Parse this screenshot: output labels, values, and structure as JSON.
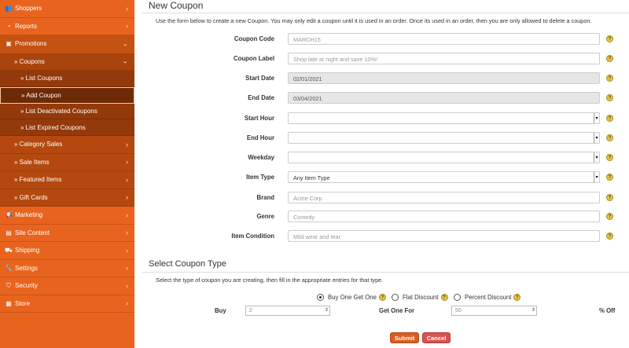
{
  "sidebar": {
    "items": [
      {
        "icon": "users-icon",
        "glyph": "👥",
        "label": "Shoppers"
      },
      {
        "icon": "chart-icon",
        "glyph": "◔",
        "label": "Reports"
      },
      {
        "icon": "promo-icon",
        "glyph": "▣",
        "label": "Promotions"
      },
      {
        "label": "» Coupons"
      },
      {
        "label": "» List Coupons"
      },
      {
        "label": "» Add Coupon"
      },
      {
        "label": "» List Deactivated Coupons"
      },
      {
        "label": "» List Expired Coupons"
      },
      {
        "label": "» Category Sales"
      },
      {
        "label": "» Sale Items"
      },
      {
        "label": "» Featured Items"
      },
      {
        "label": "» Gift Cards"
      },
      {
        "icon": "bullhorn-icon",
        "glyph": "📢",
        "label": "Marketing"
      },
      {
        "icon": "file-icon",
        "glyph": "▤",
        "label": "Site Content"
      },
      {
        "icon": "truck-icon",
        "glyph": "⛟",
        "label": "Shipping"
      },
      {
        "icon": "wrench-icon",
        "glyph": "🔧",
        "label": "Settings"
      },
      {
        "icon": "shield-icon",
        "glyph": "⛉",
        "label": "Security"
      },
      {
        "icon": "store-icon",
        "glyph": "▦",
        "label": "Store"
      }
    ]
  },
  "page": {
    "title": "New Coupon",
    "intro": "Use the form below to create a new Coupon. You may only edit a coupon until it is used in an order. Once its used in an order, then you are only allowed to delete a coupon."
  },
  "form": {
    "coupon_code": {
      "label": "Coupon Code",
      "placeholder": "MARCH15"
    },
    "coupon_label": {
      "label": "Coupon Label",
      "placeholder": "Shop late at night and save 10%!"
    },
    "start_date": {
      "label": "Start Date",
      "value": "02/01/2021"
    },
    "end_date": {
      "label": "End Date",
      "value": "03/04/2021"
    },
    "start_hour": {
      "label": "Start Hour",
      "value": ""
    },
    "end_hour": {
      "label": "End Hour",
      "value": ""
    },
    "weekday": {
      "label": "Weekday",
      "value": ""
    },
    "item_type": {
      "label": "Item Type",
      "value": "Any Item Type"
    },
    "brand": {
      "label": "Brand",
      "placeholder": "Acme Corp"
    },
    "genre": {
      "label": "Genre",
      "placeholder": "Comedy"
    },
    "item_condition": {
      "label": "Item Condition",
      "placeholder": "Mild wear and tear"
    }
  },
  "coupon_type": {
    "title": "Select Coupon Type",
    "intro": "Select the type of coupon you are creating, then fill in the appropriate entries for that type.",
    "options": [
      "Buy One Get One",
      "Flat Discount",
      "Percent Discount"
    ],
    "selected": "Buy One Get One",
    "buy_label": "Buy",
    "buy_placeholder": "2",
    "get_label": "Get One For",
    "get_placeholder": "50",
    "pct_label": "% Off"
  },
  "buttons": {
    "submit": "Submit",
    "cancel": "Cancel"
  },
  "help_glyph": "?",
  "colors": {
    "sidebar": "#e8641e",
    "accent": "#dd5d21",
    "cancel": "#d9534f"
  }
}
